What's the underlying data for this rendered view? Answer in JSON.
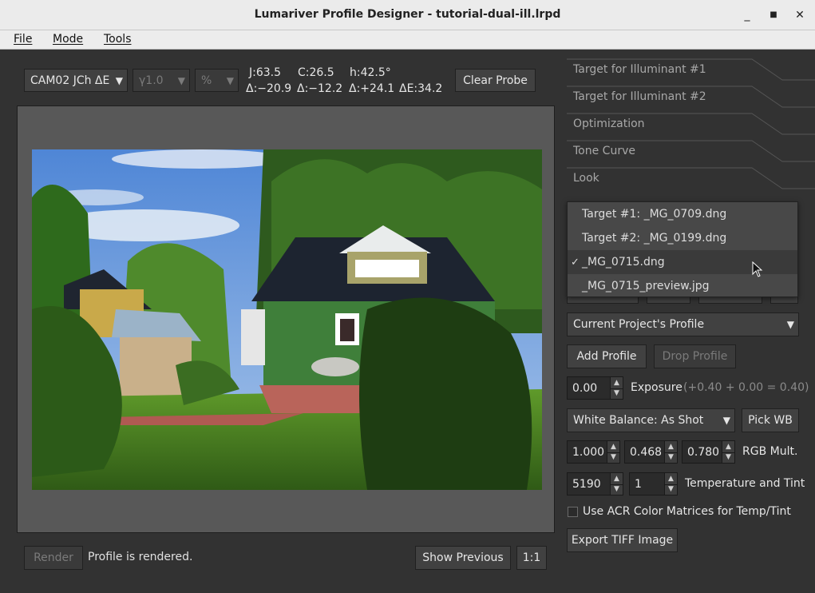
{
  "window": {
    "title": "Lumariver Profile Designer - tutorial-dual-ill.lrpd",
    "minimize_glyph": "_",
    "maximize_glyph": "■",
    "close_glyph": "✕"
  },
  "menu": [
    {
      "label": "File"
    },
    {
      "label": "Mode"
    },
    {
      "label": "Tools"
    }
  ],
  "toolbar": {
    "color_space": "CAM02 JCh ΔE",
    "gamma": "γ1.0",
    "unit": "%",
    "clear_probe": "Clear Probe",
    "probe": {
      "j": "J:63.5",
      "c": "C:26.5",
      "h": "h:42.5°",
      "dj": "Δ:−20.9",
      "dc": "Δ:−12.2",
      "dh": "Δ:+24.1",
      "de": "ΔE:34.2"
    }
  },
  "status": {
    "render": "Render",
    "message": "Profile is rendered.",
    "show_previous": "Show Previous",
    "zoom": "1:1"
  },
  "tabs": [
    {
      "label": "Target for Illuminant #1"
    },
    {
      "label": "Target for Illuminant #2"
    },
    {
      "label": "Optimization"
    },
    {
      "label": "Tone Curve"
    },
    {
      "label": "Look"
    }
  ],
  "image_dropdown": {
    "items": [
      {
        "label": "Target #1: _MG_0709.dng",
        "checked": false
      },
      {
        "label": "Target #2: _MG_0199.dng",
        "checked": false
      },
      {
        "label": "_MG_0715.dng",
        "checked": true
      },
      {
        "label": "_MG_0715_preview.jpg",
        "checked": false
      }
    ],
    "check_glyph": "✓"
  },
  "profile": {
    "select": "Current Project's Profile",
    "add": "Add Profile",
    "drop": "Drop Profile"
  },
  "exposure": {
    "value": "0.00",
    "label": "Exposure",
    "formula": "(+0.40 + 0.00 = 0.40)"
  },
  "white_balance": {
    "select": "White Balance: As Shot",
    "pick": "Pick WB"
  },
  "rgb_mult": {
    "r": "1.000",
    "g": "0.468",
    "b": "0.780",
    "label": "RGB Mult."
  },
  "temp_tint": {
    "temp": "5190",
    "tint": "1",
    "label": "Temperature and Tint"
  },
  "acr": {
    "label": "Use ACR Color Matrices for Temp/Tint",
    "checked": false
  },
  "export": {
    "label": "Export TIFF Image"
  },
  "spin_glyphs": {
    "up": "▲",
    "down": "▼"
  },
  "combo_arrow": "▼"
}
